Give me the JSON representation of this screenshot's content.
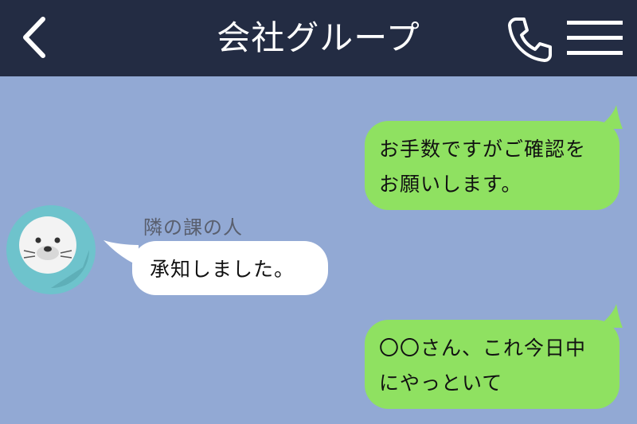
{
  "header": {
    "title": "会社グループ",
    "back_icon": "chevron-left-icon",
    "call_icon": "phone-icon",
    "menu_icon": "hamburger-menu-icon",
    "background_color": "#232c43"
  },
  "chat": {
    "background_color": "#92a9d4",
    "messages": [
      {
        "direction": "outgoing",
        "lines": [
          "お手数ですがご確認を",
          "お願いします。"
        ],
        "bubble_color": "#8fe161"
      },
      {
        "direction": "incoming",
        "sender": "隣の課の人",
        "avatar_icon": "seal-avatar-icon",
        "lines": [
          "承知しました。"
        ],
        "bubble_color": "#ffffff"
      },
      {
        "direction": "outgoing",
        "lines": [
          "〇〇さん、これ今日中",
          "にやっといて"
        ],
        "bubble_color": "#8fe161"
      }
    ]
  }
}
